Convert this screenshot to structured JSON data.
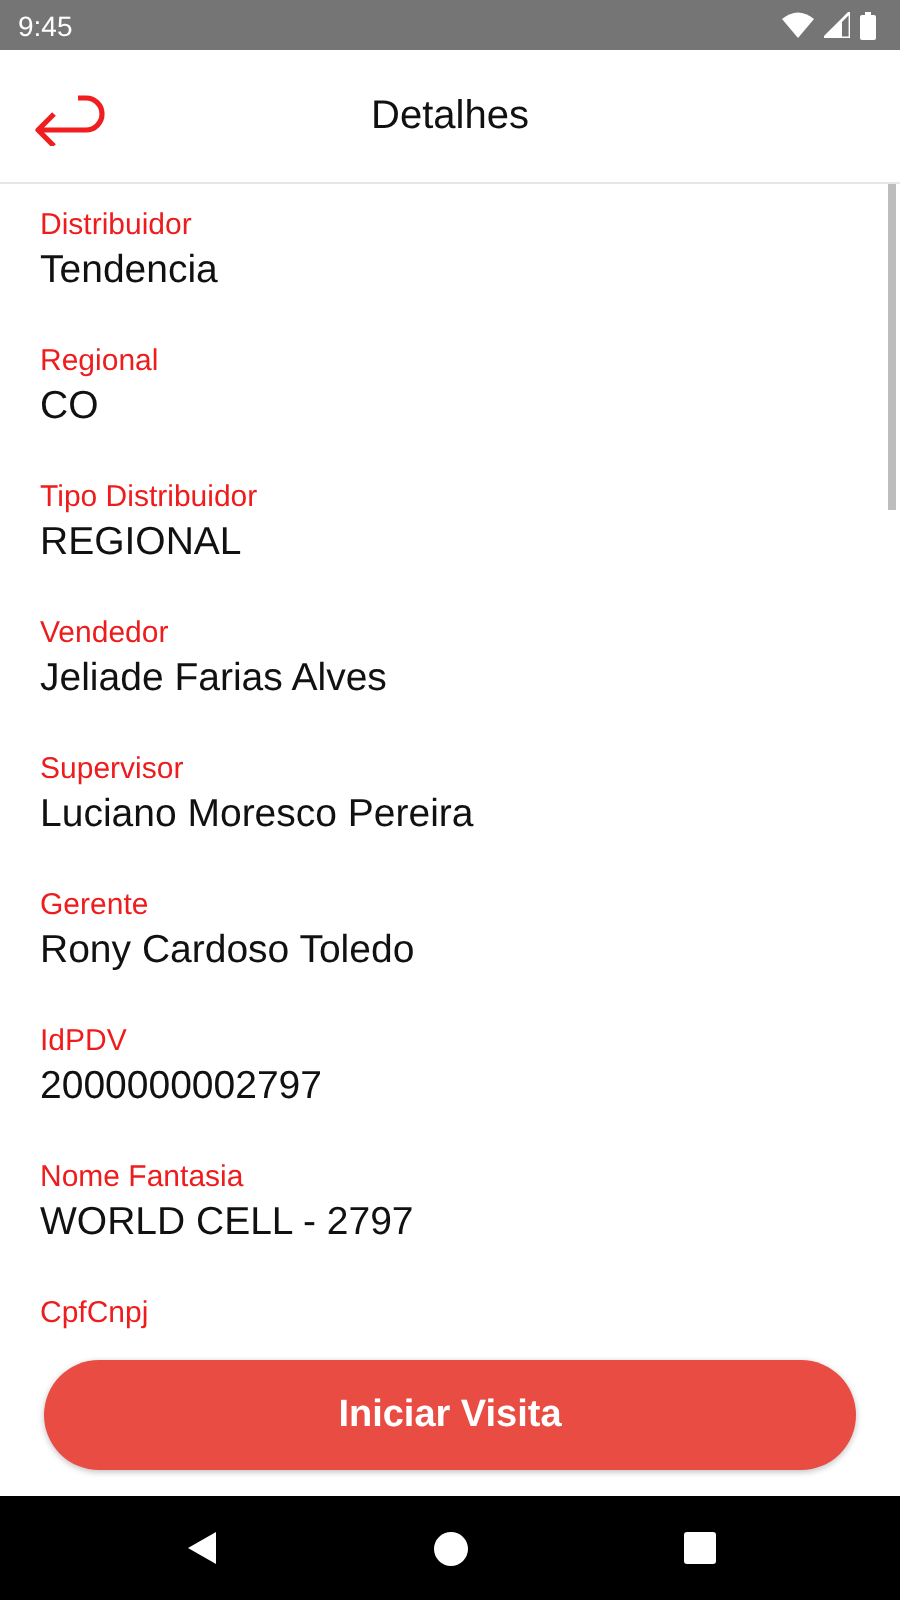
{
  "status_bar": {
    "time": "9:45"
  },
  "header": {
    "title": "Detalhes"
  },
  "fields": [
    {
      "label": "Distribuidor",
      "value": "Tendencia"
    },
    {
      "label": "Regional",
      "value": "CO"
    },
    {
      "label": "Tipo Distribuidor",
      "value": "REGIONAL"
    },
    {
      "label": "Vendedor",
      "value": "Jeliade Farias Alves"
    },
    {
      "label": "Supervisor",
      "value": "Luciano Moresco Pereira"
    },
    {
      "label": "Gerente",
      "value": "Rony Cardoso Toledo"
    },
    {
      "label": "IdPDV",
      "value": "2000000002797"
    },
    {
      "label": "Nome Fantasia",
      "value": "WORLD CELL - 2797"
    },
    {
      "label": "CpfCnpj"
    }
  ],
  "action_button": {
    "label": "Iniciar Visita"
  }
}
